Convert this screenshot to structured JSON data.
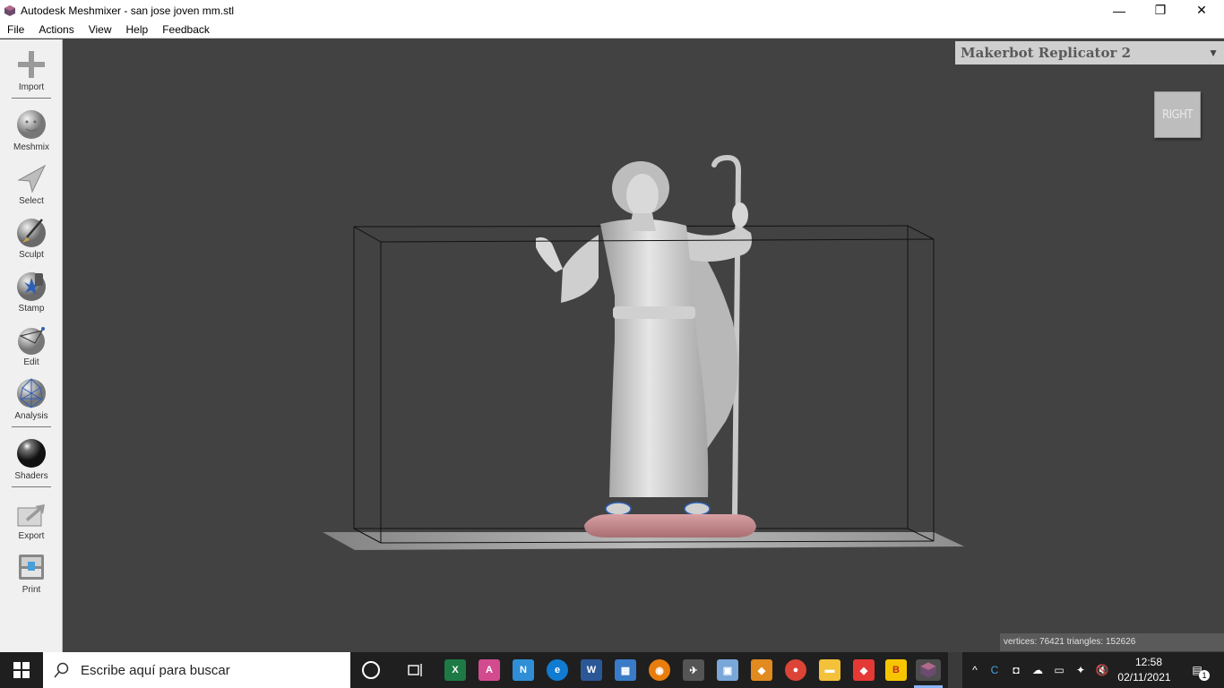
{
  "window": {
    "title": "Autodesk Meshmixer - san jose joven mm.stl",
    "minimize_glyph": "—",
    "maximize_glyph": "❐",
    "close_glyph": "✕"
  },
  "menu": [
    "File",
    "Actions",
    "View",
    "Help",
    "Feedback"
  ],
  "tools": [
    {
      "label": "Import",
      "icon": "plus-icon"
    },
    {
      "label": "Meshmix",
      "icon": "face-sphere-icon"
    },
    {
      "label": "Select",
      "icon": "arrow-select-icon"
    },
    {
      "label": "Sculpt",
      "icon": "brush-icon"
    },
    {
      "label": "Stamp",
      "icon": "stamp-icon"
    },
    {
      "label": "Edit",
      "icon": "edit-sphere-icon"
    },
    {
      "label": "Analysis",
      "icon": "analysis-sphere-icon"
    },
    {
      "label": "Shaders",
      "icon": "shader-ball-icon"
    },
    {
      "label": "Export",
      "icon": "export-icon"
    },
    {
      "label": "Print",
      "icon": "printer-icon"
    }
  ],
  "printer": {
    "name": "Makerbot Replicator 2",
    "arrow": "▼"
  },
  "viewcube": {
    "label": "RIGHT"
  },
  "stats": {
    "text": "vertices: 76421 triangles: 152626"
  },
  "taskbar": {
    "search_placeholder": "Escribe aquí para buscar",
    "time": "12:58",
    "date": "02/11/2021",
    "notification_count": "1"
  },
  "colors": {
    "viewport_bg": "#424242",
    "model": "#c8c8c8",
    "base": "#c98f92",
    "accent_blue": "#2d5fb5"
  }
}
